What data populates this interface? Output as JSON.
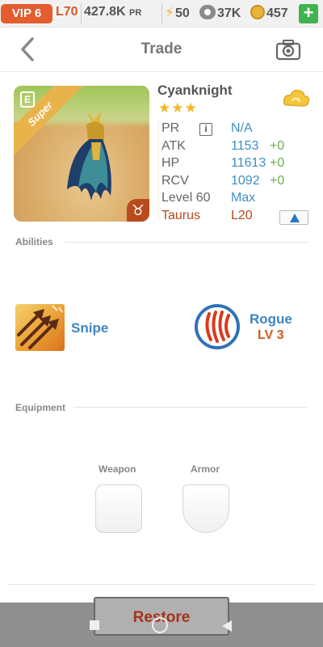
{
  "status_bar": {
    "vip": "VIP 6",
    "level": "L70",
    "power": "427.8K",
    "power_unit": "PR",
    "energy": "50",
    "paws": "37K",
    "coins": "457",
    "add_label": "+"
  },
  "header": {
    "title": "Trade",
    "back_icon": "chevron-left-icon",
    "camera_icon": "camera-icon"
  },
  "hero": {
    "name": "Cyanknight",
    "star_text": "★★★",
    "stars": 3,
    "rarity_badge": "Super",
    "badge_letter": "E",
    "zodiac_symbol": "♉",
    "stats": {
      "pr": {
        "label": "PR",
        "info": "i",
        "value": "N/A"
      },
      "atk": {
        "label": "ATK",
        "value": "1153",
        "bonus": "+0"
      },
      "hp": {
        "label": "HP",
        "value": "11613",
        "bonus": "+0"
      },
      "rcv": {
        "label": "RCV",
        "value": "1092",
        "bonus": "+0"
      },
      "level": {
        "label": "Level 60",
        "value": "Max"
      },
      "sign": {
        "label": "Taurus",
        "value": "L20"
      }
    }
  },
  "abilities": {
    "heading": "Abilities",
    "items": [
      {
        "name": "Snipe",
        "icon": "arrows-icon"
      },
      {
        "name": "Rogue",
        "level": "LV 3",
        "icon": "claw-icon"
      }
    ]
  },
  "equipment": {
    "heading": "Equipment",
    "slots": [
      {
        "label": "Weapon"
      },
      {
        "label": "Armor"
      }
    ]
  },
  "footer": {
    "restore_label": "Restore"
  },
  "colors": {
    "accent_blue": "#3f8ec8",
    "accent_orange": "#d15a22",
    "bonus_green": "#6ab04c",
    "vip_red": "#e35d2f",
    "plus_green": "#3fb34f"
  }
}
